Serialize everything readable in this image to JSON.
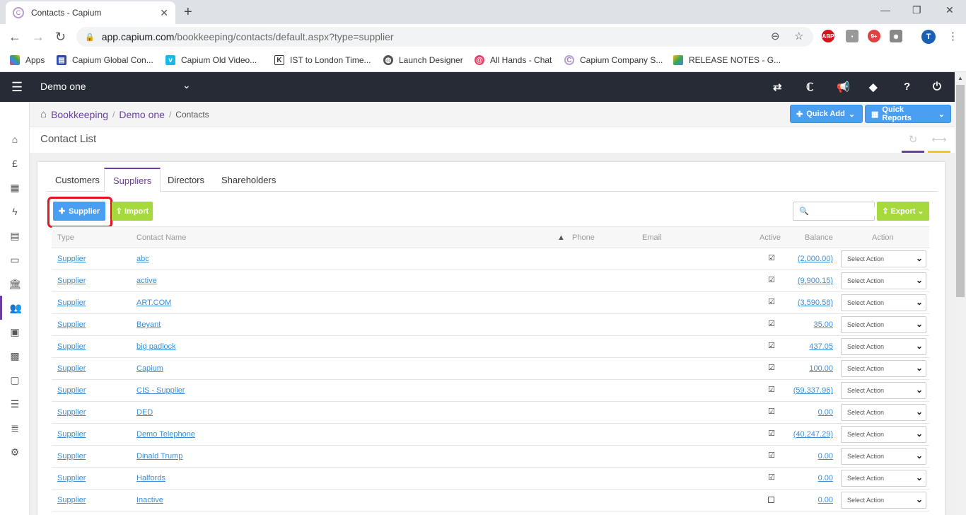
{
  "browser": {
    "tab_title": "Contacts - Capium",
    "url_host": "app.capium.com",
    "url_path": "/bookkeeping/contacts/default.aspx?type=supplier",
    "profile_initial": "T",
    "bookmarks": [
      "Apps",
      "Capium Global Con...",
      "Capium Old Video...",
      "IST to London Time...",
      "Launch Designer",
      "All Hands - Chat",
      "Capium Company S...",
      "RELEASE NOTES - G..."
    ]
  },
  "header": {
    "company": "Demo one"
  },
  "breadcrumb": {
    "root": "Bookkeeping",
    "company": "Demo one",
    "current": "Contacts"
  },
  "quick": {
    "add_label": "Quick Add",
    "reports_label": "Quick Reports"
  },
  "page": {
    "title": "Contact List"
  },
  "tabs": [
    "Customers",
    "Suppliers",
    "Directors",
    "Shareholders"
  ],
  "toolbar": {
    "supplier_label": "Supplier",
    "import_label": "Import",
    "export_label": "Export",
    "search_placeholder": ""
  },
  "table": {
    "headers": {
      "type": "Type",
      "name": "Contact Name",
      "phone": "Phone",
      "email": "Email",
      "active": "Active",
      "balance": "Balance",
      "action": "Action"
    },
    "rows": [
      {
        "type": "Supplier",
        "name": "abc",
        "active": true,
        "balance": "(2,000.00)",
        "action": "Select Action"
      },
      {
        "type": "Supplier",
        "name": "active",
        "active": true,
        "balance": "(9,900.15)",
        "action": "Select Action"
      },
      {
        "type": "Supplier",
        "name": "ART.COM",
        "active": true,
        "balance": "(3,590.58)",
        "action": "Select Action"
      },
      {
        "type": "Supplier",
        "name": "Beyant",
        "active": true,
        "balance": "35.00",
        "action": "Select Action"
      },
      {
        "type": "Supplier",
        "name": "big padlock",
        "active": true,
        "balance": "437.05",
        "action": "Select Action"
      },
      {
        "type": "Supplier",
        "name": "Capium",
        "active": true,
        "balance": "100.00",
        "action": "Select Action"
      },
      {
        "type": "Supplier",
        "name": "CIS - Supplier",
        "active": true,
        "balance": "(59,337.96)",
        "action": "Select Action"
      },
      {
        "type": "Supplier",
        "name": "DED",
        "active": true,
        "balance": "0.00",
        "action": "Select Action"
      },
      {
        "type": "Supplier",
        "name": "Demo Telephone",
        "active": true,
        "balance": "(40,247.29)",
        "action": "Select Action"
      },
      {
        "type": "Supplier",
        "name": "Dinald Trump",
        "active": true,
        "balance": "0.00",
        "action": "Select Action"
      },
      {
        "type": "Supplier",
        "name": "Halfords",
        "active": true,
        "balance": "0.00",
        "action": "Select Action"
      },
      {
        "type": "Supplier",
        "name": "Inactive",
        "active": false,
        "balance": "0.00",
        "action": "Select Action"
      }
    ]
  },
  "colors": {
    "header_bg": "#262b36",
    "accent_purple": "#6a3fa0",
    "button_blue": "#4b9ff2",
    "button_green": "#a6d93b",
    "highlight_red": "#e0161e",
    "link_blue": "#3b8fd9"
  }
}
